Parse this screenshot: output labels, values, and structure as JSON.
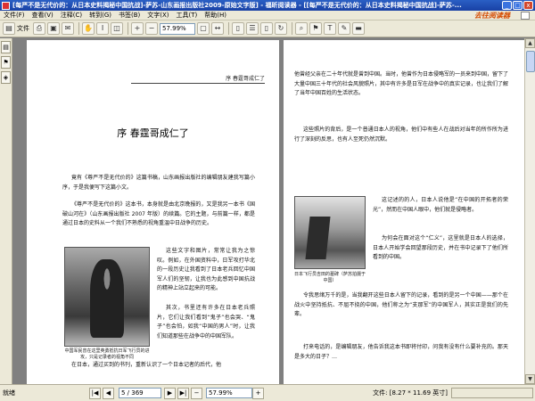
{
  "window": {
    "title": "[每严不是无代价的：从日本史料揭秘中国抗战]-萨苏-山东画报出版社2009-原始文字版] - 福昕阅读器 - [[每严不是无代价的：从日本史料揭秘中国抗战]-萨苏-...",
    "min_label": "_",
    "max_label": "□",
    "close_label": "x"
  },
  "menu": {
    "items": [
      "文件(F)",
      "查看(V)",
      "注释(C)",
      "转到(G)",
      "书签(B)",
      "文字(X)",
      "工具(T)",
      "帮助(H)"
    ],
    "brand": "去往阅读器"
  },
  "toolbar": {
    "open_label": "文件",
    "zoom_value": "57.99%",
    "icons": [
      "open-icon",
      "print-icon",
      "save-icon",
      "email-icon",
      "hand-icon",
      "select-text-icon",
      "snapshot-icon",
      "zoom-in-icon",
      "zoom-out-icon",
      "fit-page-icon",
      "fit-width-icon",
      "single-page-icon",
      "continuous-icon",
      "facing-icon",
      "rotate-icon",
      "search-icon",
      "bookmark-icon",
      "typewriter-icon",
      "note-icon",
      "highlight-icon"
    ]
  },
  "document": {
    "left_page": {
      "header": "序  春霆哥成仁了",
      "chapter_title": "序  春霆哥成仁了",
      "paragraphs": [
        "竟有《尊严不是无代价的》这篇书稿，山东画报出版社的编辑朋友建我写篇小序，于是我便写下这篇小文。",
        "《尊严不是无代价的》这本书，本身就是由北京晚报的，又是我另一本书《国破山河在》（山东画报出版社 2007 年版）的续篇。它的主题，与前篇一样，都是通过日本的史料从一个我们不熟悉的视角重温中日战争的历史。",
        "这些文字和图片，常常让我为之惊叹。例如，在外国资料中，日军攻打华北的一段历史让我看到了日本老兵回忆中国军人们的坚韧，让我也为此感到中国抗战的精神上站立起来的可能。",
        "其次，书里还有许多在日本老兵照片，它们让我们看到“鬼子”也会哭、“鬼子”也会怕，如我“中国的男人”时，让我们知道那些在战争中的中国军队。",
        "英雄，殉国在异国异乡的他们，他们的故事，对我们来说同样值得讲述，这样我们了解了的历史便更全面，不再仅仅停留在口号与传说上。",
        "比如，一块日军为其两次运动中阵亡的飞行员修建的墓碑…",
        "在日本，通过买到的书刊，重新认识了一个日本记者的后代，他"
      ],
      "photo_caption": "中国军民曾在这里英勇抵抗日军飞行员的进攻，只是记录者的视角不同"
    },
    "right_page": {
      "paragraphs": [
        "他曾经父亲在二十年代就是曾到中国。当时，他曾作为日本侵略军的一员来到中国，留下了大量中国三十年代的社会风貌照片，其中有许多是日军在战争中的真实记录，也让我们了解了当年中国百姓的生活状态。",
        "这些照片的背后，是一个普通日本人的视角，他们中有些人在战后对当年的所作所为进行了深刻的反思，也有人至死仍然沉默。",
        "这记述的的人，日本人说他是“在中国的开拓者的荣光”，然而在中国人眼中，他们就是侵略者。",
        "为何会在面对这个“仁义”，这里就是日本人的选择，日本人开始学会回望那段历史，并在书中记录下了他们所看到的中国。",
        "令我思绪万千的是，当我翻开这些日本人留下的记录，看到的是另一个中国——那个在战火中坚持抵抗、不屈不挠的中国，他们称之为“支那军”的中国军人，其实正是我们的先辈。",
        "打来电话的，是编辑朋友，他告诉我这本书即将付印，问我有没有什么要补充的。那天是多大的日子？…"
      ],
      "photo_caption": "日本飞行员吉田的墓碑（萨苏拍摄于中国）"
    }
  },
  "sidepanel": {
    "icons": [
      "pages-icon",
      "bookmarks-icon",
      "layers-icon"
    ]
  },
  "statusbar": {
    "ready": "就绪",
    "page_value": "5 / 369",
    "zoom_value": "57.99%",
    "file_size_label": "文件: [8.27 * 11.69 英寸]"
  }
}
